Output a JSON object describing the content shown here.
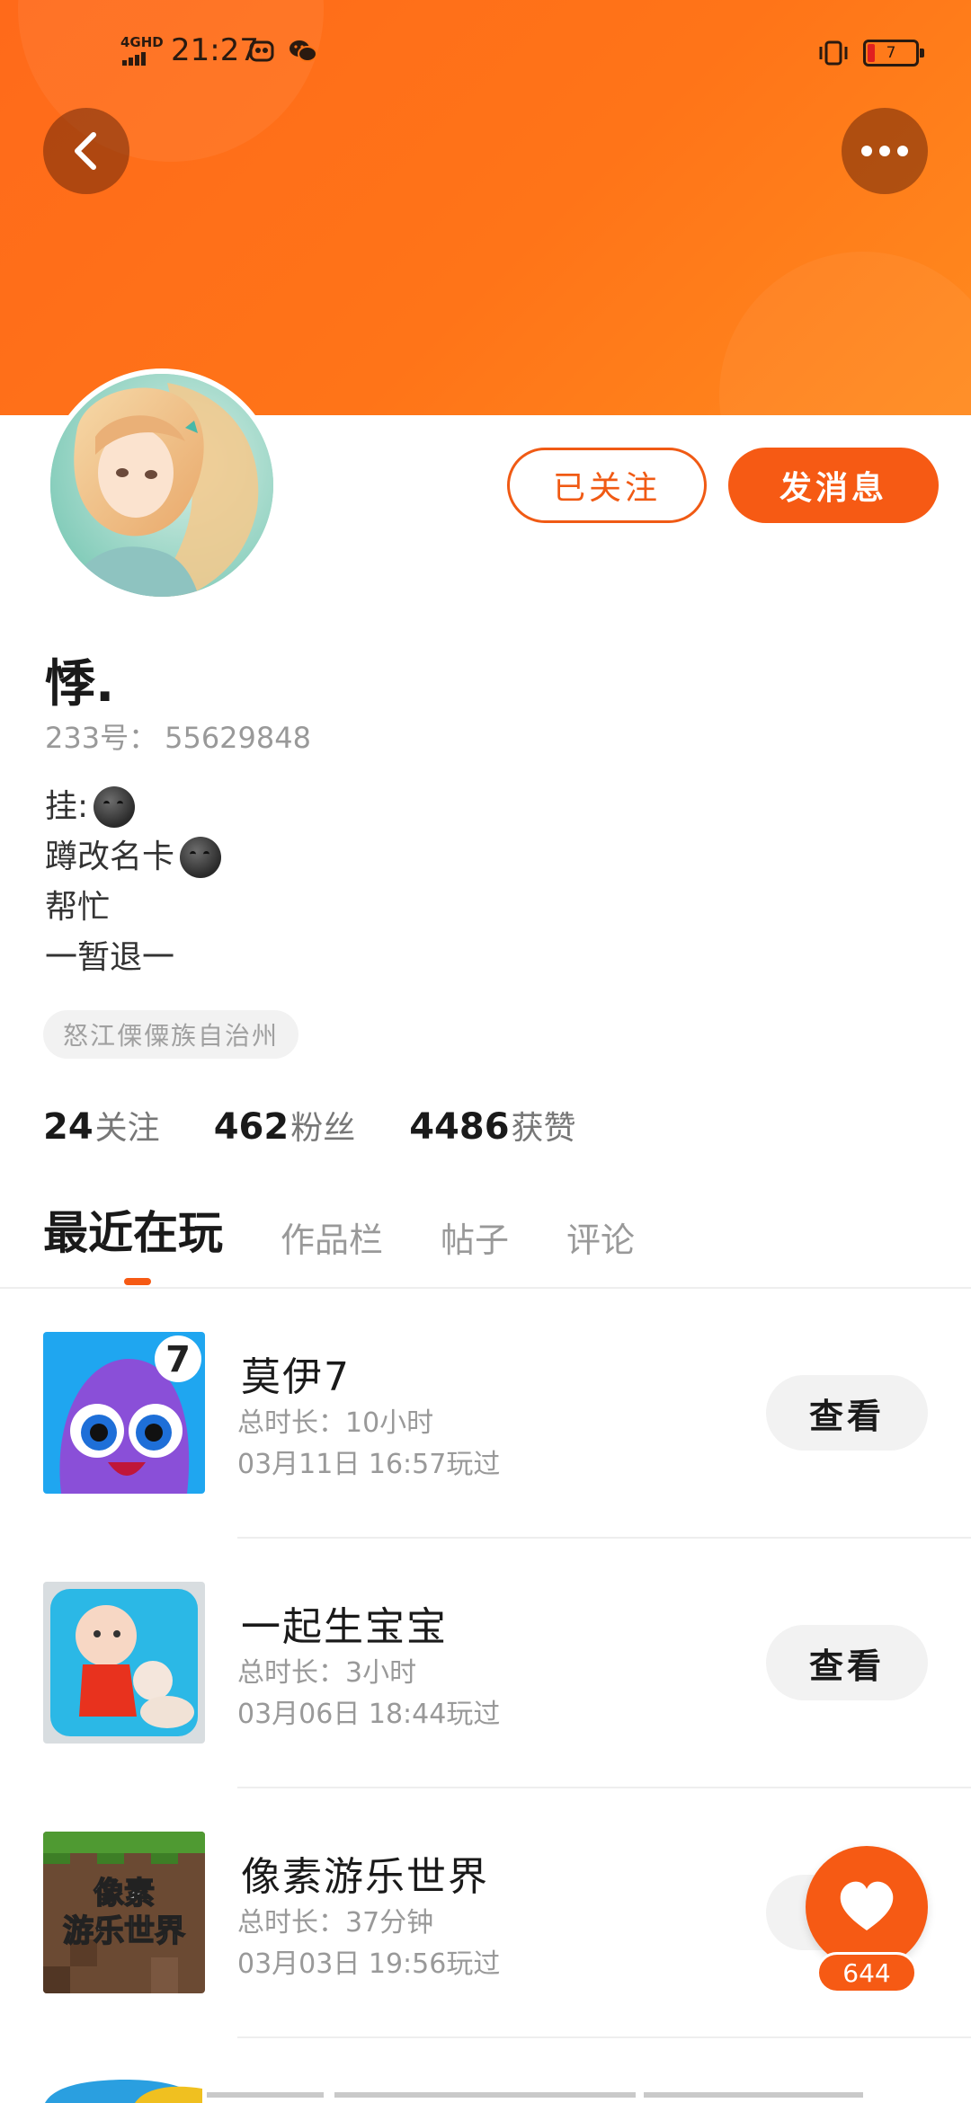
{
  "status_bar": {
    "network": "4GHD",
    "time": "21:27",
    "battery": "7"
  },
  "header": {
    "back_icon": "chevron-left-icon",
    "more_icon": "more-dots-icon"
  },
  "profile": {
    "username": "悸.",
    "id_label": "233号：",
    "id_value": "55629848",
    "bio": [
      {
        "text": "挂:",
        "emoji": true
      },
      {
        "text": "蹲改名卡",
        "emoji": true
      },
      {
        "text": "帮忙",
        "emoji": false
      },
      {
        "text": "一暂退一",
        "emoji": false
      }
    ],
    "location": "怒江傈僳族自治州"
  },
  "actions": {
    "following_label": "已关注",
    "message_label": "发消息"
  },
  "stats": [
    {
      "value": "24",
      "label": "关注"
    },
    {
      "value": "462",
      "label": "粉丝"
    },
    {
      "value": "4486",
      "label": "获赞"
    }
  ],
  "tabs": [
    {
      "label": "最近在玩",
      "active": true
    },
    {
      "label": "作品栏",
      "active": false
    },
    {
      "label": "帖子",
      "active": false
    },
    {
      "label": "评论",
      "active": false
    }
  ],
  "games": [
    {
      "name": "莫伊7",
      "duration": "总时长：10小时",
      "last_played": "03月11日 16:57玩过",
      "button": "查看"
    },
    {
      "name": "一起生宝宝",
      "duration": "总时长：3小时",
      "last_played": "03月06日 18:44玩过",
      "button": "查看"
    },
    {
      "name": "像素游乐世界",
      "duration": "总时长：37分钟",
      "last_played": "03月03日 19:56玩过",
      "button": "查看"
    }
  ],
  "game3_icon_text": [
    "像素",
    "游乐世界"
  ],
  "like_fab": {
    "icon": "heart-icon",
    "count": "644"
  },
  "colors": {
    "accent": "#f65a14",
    "header_gradient_start": "#ff6a1a",
    "header_gradient_end": "#ff8a1e"
  }
}
